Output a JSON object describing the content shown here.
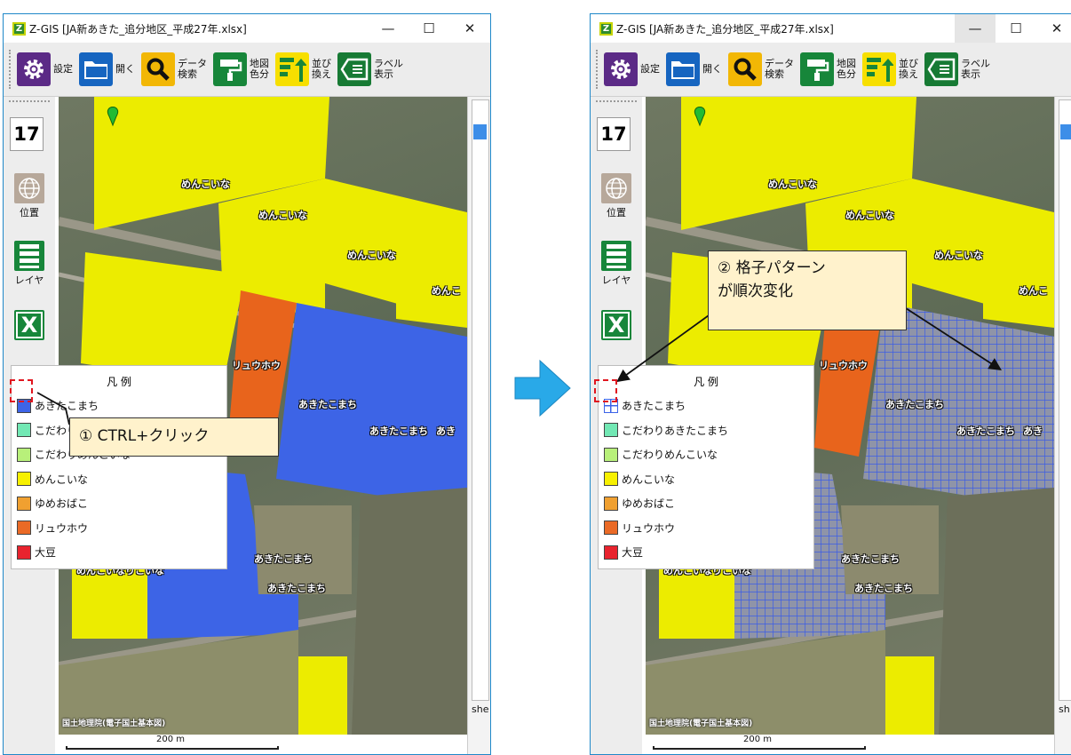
{
  "window": {
    "title": "Z-GIS [JA新あきた_追分地区_平成27年.xlsx]",
    "minimize_glyph": "—",
    "maximize_glyph": "☐",
    "close_glyph": "✕"
  },
  "toolbar": {
    "settings_label": "設定",
    "open_label": "開く",
    "search_label": "データ\n検索",
    "color_label": "地図\n色分",
    "sort_label": "並び\n換え",
    "label_label": "ラベル\n表示"
  },
  "sidebar": {
    "zoom_level": "17",
    "position_label": "位置",
    "layer_label": "レイヤ",
    "excel_glyph": "X"
  },
  "legend": {
    "title": "凡 例",
    "items": [
      {
        "label": "あきたこまち",
        "color": "#3d64e8"
      },
      {
        "label": "こだわりあきたこまち",
        "color": "#72e8b4"
      },
      {
        "label": "こだわりめんこいな",
        "color": "#b8f07a"
      },
      {
        "label": "めんこいな",
        "color": "#f7f000"
      },
      {
        "label": "ゆめおばこ",
        "color": "#f0a030"
      },
      {
        "label": "リュウホウ",
        "color": "#ea6a26"
      },
      {
        "label": "大豆",
        "color": "#e8232e"
      }
    ]
  },
  "map": {
    "labels": {
      "menkoina": "めんこいな",
      "menko": "めんこ",
      "ryuho": "リュウホウ",
      "akita": "あきたこまち",
      "akita_short": "あき",
      "mixed": "めんこいなりこいな"
    },
    "attribution": "国土地理院(電子国土基本図)",
    "scale": "200 m"
  },
  "rightpanel": {
    "tab_left": "she",
    "tab_right": "sh"
  },
  "annotations": {
    "step1": "① CTRL+クリック",
    "step2_line1": "② 格子パターン",
    "step2_line2": "が順次変化"
  },
  "colors": {
    "accent_arrow": "#29a9e8",
    "callout_bg": "#fff2cc",
    "pattern_grid": "#3b5ce6"
  }
}
